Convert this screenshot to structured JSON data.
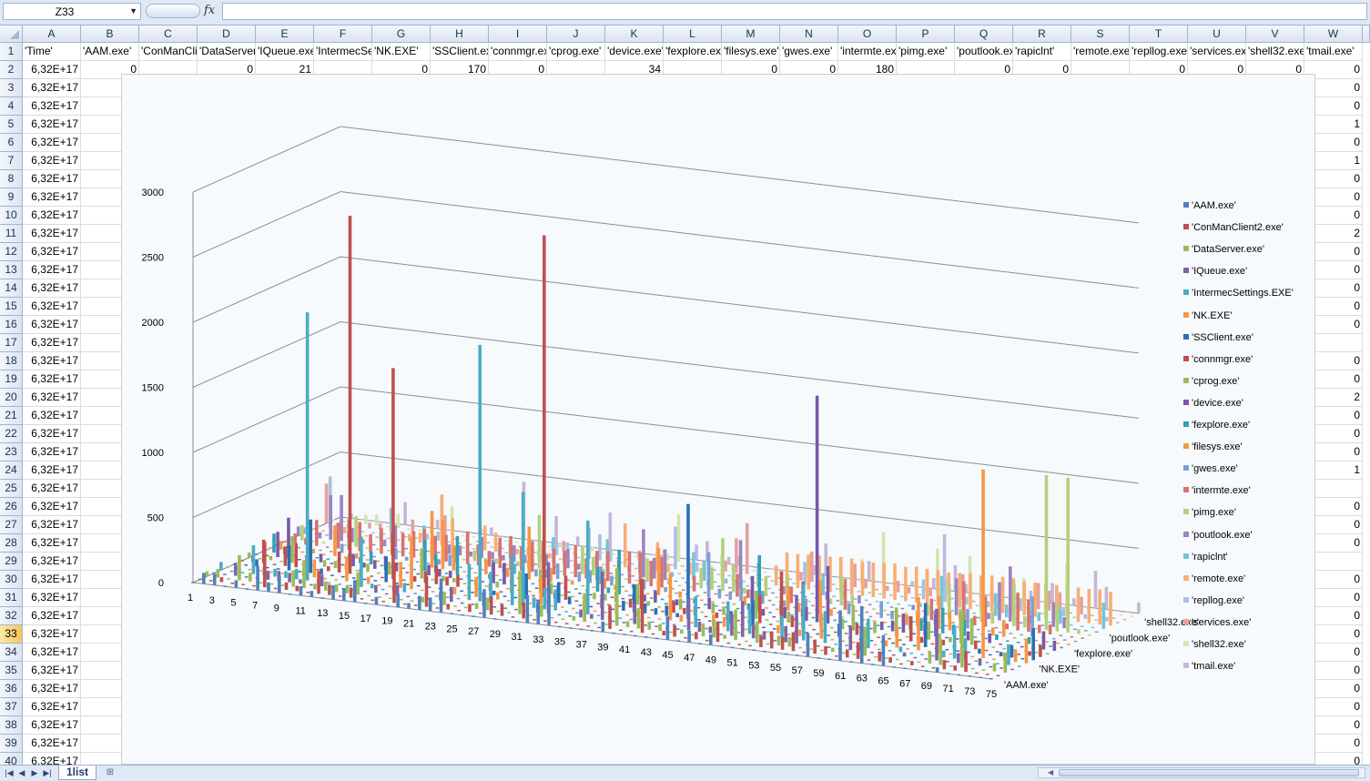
{
  "formula_bar": {
    "name_box": "Z33",
    "fx_label": "fx",
    "formula": ""
  },
  "columns": [
    "A",
    "B",
    "C",
    "D",
    "E",
    "F",
    "G",
    "H",
    "I",
    "J",
    "K",
    "L",
    "M",
    "N",
    "O",
    "P",
    "Q",
    "R",
    "S",
    "T",
    "U",
    "V",
    "W"
  ],
  "header_row": [
    "'Time'",
    "'AAM.exe'",
    "'ConManClient2.exe'",
    "'DataServer.exe'",
    "'IQueue.exe'",
    "'IntermecSettings.EXE'",
    "'NK.EXE'",
    "'SSClient.exe'",
    "'connmgr.exe'",
    "'cprog.exe'",
    "'device.exe'",
    "'fexplore.exe'",
    "'filesys.exe'",
    "'gwes.exe'",
    "'intermte.exe'",
    "'pimg.exe'",
    "'poutlook.exe'",
    "'rapiclnt'",
    "'remote.exe'",
    "'repllog.exe'",
    "'services.exe'",
    "'shell32.exe'",
    "'tmail.exe'"
  ],
  "row2": [
    "6,32E+17",
    "0",
    "",
    "0",
    "21",
    "",
    "0",
    "170",
    "0",
    "",
    "34",
    "",
    "0",
    "0",
    "180",
    "",
    "0",
    "0",
    "",
    "0",
    "0",
    "0",
    "0"
  ],
  "time_value": "6,32E+17",
  "col_w_values": {
    "3": "0",
    "4": "0",
    "5": "1",
    "6": "0",
    "7": "1",
    "8": "0",
    "9": "0",
    "10": "0",
    "11": "2",
    "12": "0",
    "13": "0",
    "14": "0",
    "15": "0",
    "16": "0",
    "18": "0",
    "19": "0",
    "20": "2",
    "21": "0",
    "22": "0",
    "23": "0",
    "24": "1",
    "26": "0",
    "27": "0",
    "28": "0",
    "30": "0",
    "31": "0",
    "32": "0",
    "33": "0",
    "34": "0",
    "35": "0",
    "36": "0",
    "37": "0",
    "38": "0",
    "39": "0",
    "40": "0"
  },
  "selected_row": 33,
  "sheet_tabs": [
    "1list"
  ],
  "chart_data": {
    "type": "bar3d",
    "y_axis_ticks": [
      "0",
      "500",
      "1000",
      "1500",
      "2000",
      "2500",
      "3000"
    ],
    "ylim": [
      0,
      3000
    ],
    "x_axis_ticks": [
      "1",
      "3",
      "5",
      "7",
      "9",
      "11",
      "13",
      "15",
      "17",
      "19",
      "21",
      "23",
      "25",
      "27",
      "29",
      "31",
      "33",
      "35",
      "37",
      "39",
      "41",
      "43",
      "45",
      "47",
      "49",
      "51",
      "53",
      "55",
      "57",
      "59",
      "61",
      "63",
      "65",
      "67",
      "69",
      "71",
      "73",
      "75"
    ],
    "depth_axis_ticks": [
      "'AAM.exe'",
      "'NK.EXE'",
      "'fexplore.exe'",
      "'poutlook.exe'",
      "'shell32.exe'"
    ],
    "legend_position": "right",
    "series": [
      {
        "name": "'AAM.exe'",
        "color": "#4f81bd"
      },
      {
        "name": "'ConManClient2.exe'",
        "color": "#c0504d"
      },
      {
        "name": "'DataServer.exe'",
        "color": "#9bbb59"
      },
      {
        "name": "'IQueue.exe'",
        "color": "#8064a2"
      },
      {
        "name": "'IntermecSettings.EXE'",
        "color": "#4bacc6"
      },
      {
        "name": "'NK.EXE'",
        "color": "#f79646"
      },
      {
        "name": "'SSClient.exe'",
        "color": "#2c6fb5"
      },
      {
        "name": "'connmgr.exe'",
        "color": "#c0504d"
      },
      {
        "name": "'cprog.exe'",
        "color": "#9bbb59"
      },
      {
        "name": "'device.exe'",
        "color": "#7a58a8"
      },
      {
        "name": "'fexplore.exe'",
        "color": "#31a0b5"
      },
      {
        "name": "'filesys.exe'",
        "color": "#f79646"
      },
      {
        "name": "'gwes.exe'",
        "color": "#7b9fd3"
      },
      {
        "name": "'intermte.exe'",
        "color": "#d9736f"
      },
      {
        "name": "'pimg.exe'",
        "color": "#b4d07b"
      },
      {
        "name": "'poutlook.exe'",
        "color": "#9c84c0"
      },
      {
        "name": "'rapiclnt'",
        "color": "#77c4d7"
      },
      {
        "name": "'remote.exe'",
        "color": "#f9ae74"
      },
      {
        "name": "'repllog.exe'",
        "color": "#a9c0e3"
      },
      {
        "name": "'services.exe'",
        "color": "#e6a09e"
      },
      {
        "name": "'shell32.exe'",
        "color": "#d4e4b0"
      },
      {
        "name": "'tmail.exe'",
        "color": "#c4b6d9"
      }
    ],
    "peaks": [
      {
        "series": "'IntermecSettings.EXE'",
        "x": 9,
        "value": 2060
      },
      {
        "series": "'connmgr.exe'",
        "x": 11,
        "value": 2750
      },
      {
        "series": "'connmgr.exe'",
        "x": 15,
        "value": 1620
      },
      {
        "series": "'IntermecSettings.EXE'",
        "x": 25,
        "value": 1970
      },
      {
        "series": "'connmgr.exe'",
        "x": 29,
        "value": 2780
      },
      {
        "series": "'IntermecSettings.EXE'",
        "x": 29,
        "value": 880
      },
      {
        "series": "'SSClient.exe'",
        "x": 43,
        "value": 880
      },
      {
        "series": "'IntermecSettings.EXE'",
        "x": 35,
        "value": 720
      },
      {
        "series": "'device.exe'",
        "x": 53,
        "value": 1740
      },
      {
        "series": "'NK.EXE'",
        "x": 71,
        "value": 1450
      },
      {
        "series": "'pimg.exe'",
        "x": 71,
        "value": 1190
      },
      {
        "series": "'pimg.exe'",
        "x": 73,
        "value": 1190
      }
    ]
  }
}
